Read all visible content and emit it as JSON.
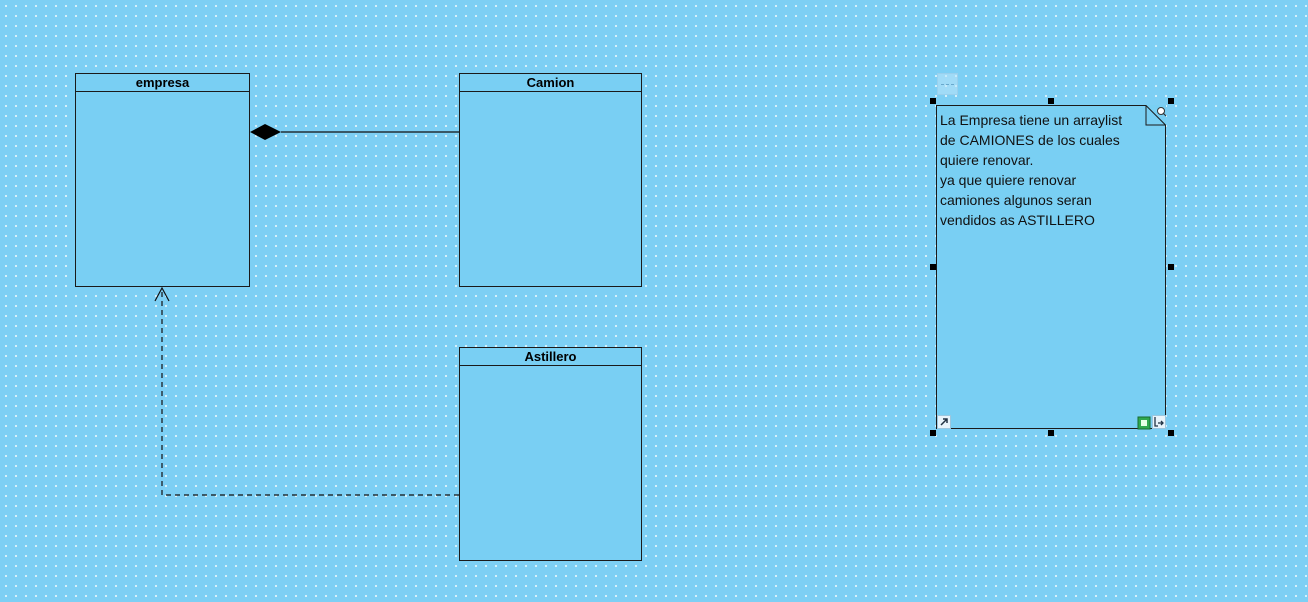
{
  "diagram": {
    "classes": [
      {
        "id": "empresa",
        "name": "empresa"
      },
      {
        "id": "camion",
        "name": "Camion"
      },
      {
        "id": "astillero",
        "name": "Astillero"
      }
    ],
    "relations": [
      {
        "type": "composition",
        "from": "empresa",
        "to": "camion"
      },
      {
        "type": "dependency",
        "from": "astillero",
        "to": "empresa"
      }
    ],
    "note": {
      "text": "La Empresa tiene un arraylist\nde CAMIONES de los cuales\nquiere renovar.\nya que quiere renovar\ncamiones algunos seran\nvendidos as ASTILLERO"
    }
  },
  "colors": {
    "canvas_background": "#7dcff4",
    "shape_fill": "#79cff3",
    "stroke": "#1a1a1a",
    "selection_handle": "#000000"
  },
  "icons": {
    "note_link": "arrow-link-icon",
    "note_resource": "resource-catalog-icon",
    "note_layout": "auto-fit-icon",
    "note_resize": "resize-corner-icon",
    "stereotype_tab": "stereotype-tab-icon"
  }
}
